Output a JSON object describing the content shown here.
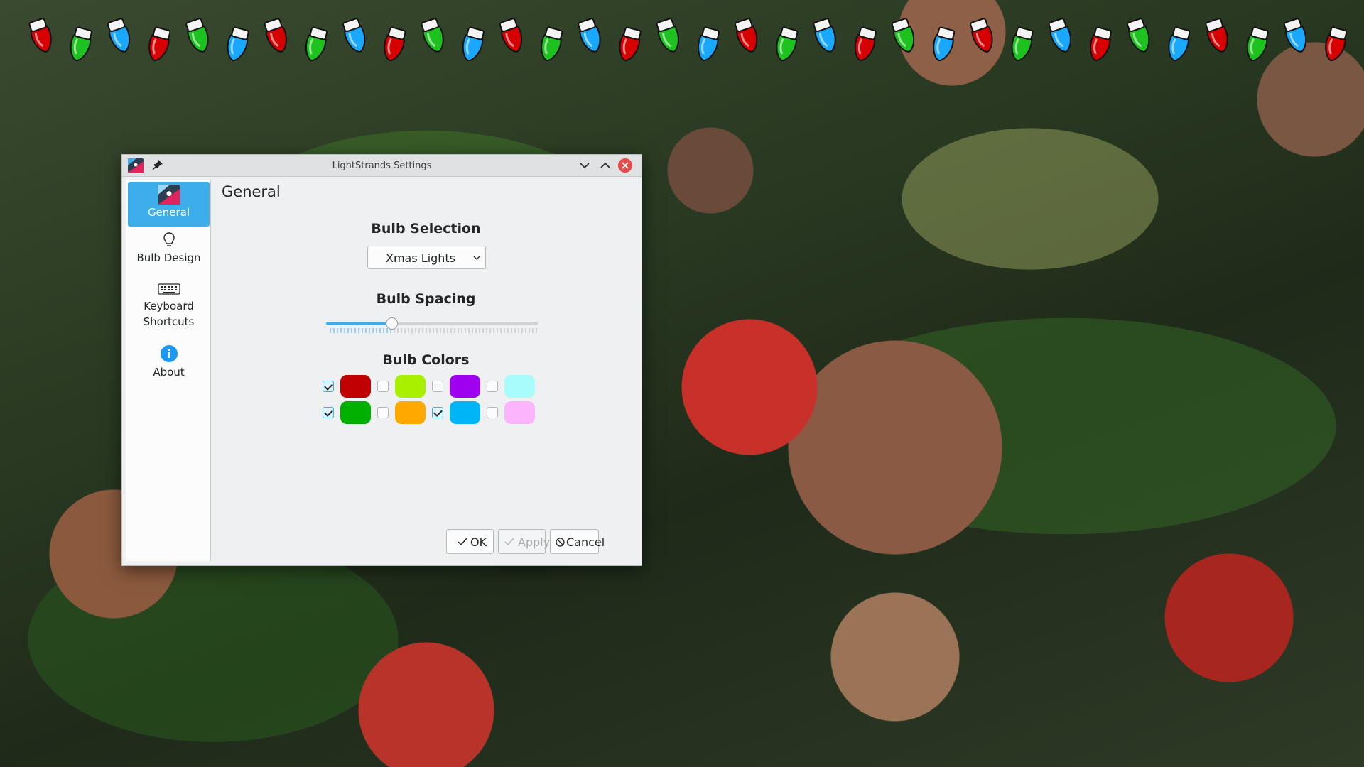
{
  "window": {
    "title": "LightStrands Settings"
  },
  "sidebar": {
    "items": [
      {
        "label": "General",
        "icon": "app-icon",
        "active": true
      },
      {
        "label": "Bulb Design",
        "icon": "lightbulb-icon"
      },
      {
        "label_line1": "Keyboard",
        "label_line2": "Shortcuts",
        "icon": "keyboard-icon"
      },
      {
        "label": "About",
        "icon": "info-icon"
      }
    ]
  },
  "page": {
    "title": "General",
    "bulb_selection": {
      "heading": "Bulb Selection",
      "value": "Xmas Lights"
    },
    "bulb_spacing": {
      "heading": "Bulb Spacing",
      "value_fraction": 0.31
    },
    "bulb_colors": {
      "heading": "Bulb Colors",
      "items": [
        {
          "color": "#c00000",
          "checked": true
        },
        {
          "color": "#a8f000",
          "checked": false
        },
        {
          "color": "#a000f0",
          "checked": false
        },
        {
          "color": "#a8fcfc",
          "checked": false
        },
        {
          "color": "#00b000",
          "checked": true
        },
        {
          "color": "#ffa800",
          "checked": false
        },
        {
          "color": "#00b4f8",
          "checked": true
        },
        {
          "color": "#fcb4fc",
          "checked": false
        }
      ]
    }
  },
  "buttons": {
    "ok": "OK",
    "apply": "Apply",
    "cancel": "Cancel"
  },
  "colors": {
    "accent": "#3daee9",
    "close": "#e74c4c"
  },
  "lights": [
    "red",
    "green",
    "blue",
    "red",
    "green",
    "blue",
    "red",
    "green",
    "blue",
    "red",
    "green",
    "blue",
    "red",
    "green",
    "blue",
    "red",
    "green",
    "blue",
    "red",
    "green",
    "blue",
    "red",
    "green",
    "blue",
    "red",
    "green",
    "blue",
    "red",
    "green",
    "blue",
    "red",
    "green",
    "blue",
    "red"
  ]
}
